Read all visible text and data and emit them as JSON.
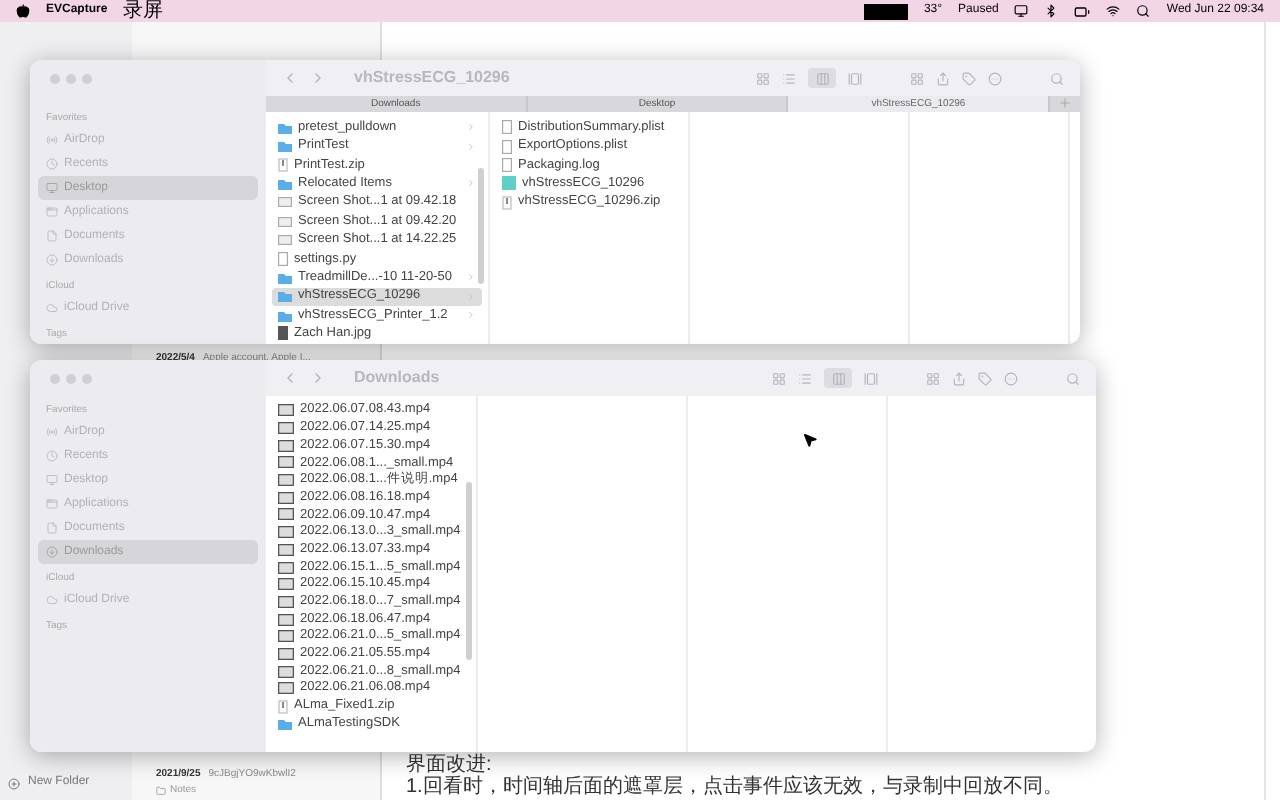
{
  "menu_bar": {
    "app_name": "EVCapture",
    "menu_items": [
      "录屏"
    ],
    "status_items": [
      "33°",
      "Paused"
    ],
    "clock": "Wed Jun 22 09:34"
  },
  "background_app": {
    "notes": [
      {
        "date": "2022/5/4",
        "title": "Apple account. Apple I..."
      },
      {
        "date": "2021/9/25",
        "title": "9cJBgjYO9wKbwlI2",
        "folder": "Notes"
      }
    ],
    "body_heading": "界面改进:",
    "body_text": "1.回看时，时间轴后面的遮罩层，点击事件应该无效，与录制中回放不同。",
    "new_folder": "New Folder"
  },
  "windows": [
    {
      "title": "vhStressECG_10296",
      "tabs": [
        {
          "label": "Downloads",
          "selected": false
        },
        {
          "label": "Desktop",
          "selected": false
        },
        {
          "label": "vhStressECG_10296",
          "selected": true
        }
      ],
      "sidebar": [
        {
          "heading": "Favorites",
          "items": [
            {
              "label": "AirDrop",
              "kind": "airdrop",
              "selected": false
            },
            {
              "label": "Recents",
              "kind": "recents",
              "selected": false
            },
            {
              "label": "Desktop",
              "kind": "desktop",
              "selected": true
            },
            {
              "label": "Applications",
              "kind": "applications",
              "selected": false
            },
            {
              "label": "Documents",
              "kind": "documents",
              "selected": false
            },
            {
              "label": "Downloads",
              "kind": "downloads",
              "selected": false
            }
          ]
        },
        {
          "heading": "iCloud",
          "items": [
            {
              "label": "iCloud Drive",
              "kind": "cloud",
              "selected": false
            }
          ]
        },
        {
          "heading": "Tags"
        }
      ],
      "columns": [
        [
          {
            "name": "pretest_pulldown",
            "kind": "folder",
            "selected": false,
            "has_children": true
          },
          {
            "name": "PrintTest",
            "kind": "folder",
            "selected": false,
            "has_children": true
          },
          {
            "name": "PrintTest.zip",
            "kind": "zip",
            "selected": false,
            "has_children": false
          },
          {
            "name": "Relocated Items",
            "kind": "folder",
            "selected": false,
            "has_children": true
          },
          {
            "name": "Screen Shot...1 at 09.42.18",
            "kind": "image",
            "selected": false,
            "has_children": false
          },
          {
            "name": "Screen Shot...1 at 09.42.20",
            "kind": "image",
            "selected": false,
            "has_children": false
          },
          {
            "name": "Screen Shot...1 at 14.22.25",
            "kind": "image",
            "selected": false,
            "has_children": false
          },
          {
            "name": "settings.py",
            "kind": "document",
            "selected": false,
            "has_children": false
          },
          {
            "name": "TreadmillDe...-10 11-20-50",
            "kind": "folder",
            "selected": false,
            "has_children": true
          },
          {
            "name": "vhStressECG_10296",
            "kind": "folder",
            "selected": true,
            "has_children": true
          },
          {
            "name": "vhStressECG_Printer_1.2",
            "kind": "folder",
            "selected": false,
            "has_children": true
          },
          {
            "name": "Zach Han.jpg",
            "kind": "photo",
            "selected": false,
            "has_children": false
          }
        ],
        [
          {
            "name": "DistributionSummary.plist",
            "kind": "document",
            "selected": false,
            "has_children": false
          },
          {
            "name": "ExportOptions.plist",
            "kind": "document",
            "selected": false,
            "has_children": false
          },
          {
            "name": "Packaging.log",
            "kind": "document",
            "selected": false,
            "has_children": false
          },
          {
            "name": "vhStressECG_10296",
            "kind": "app",
            "selected": false,
            "has_children": false
          },
          {
            "name": "vhStressECG_10296.zip",
            "kind": "zip",
            "selected": false,
            "has_children": false
          }
        ],
        [],
        []
      ]
    },
    {
      "title": "Downloads",
      "sidebar": [
        {
          "heading": "Favorites",
          "items": [
            {
              "label": "AirDrop",
              "kind": "airdrop",
              "selected": false
            },
            {
              "label": "Recents",
              "kind": "recents",
              "selected": false
            },
            {
              "label": "Desktop",
              "kind": "desktop",
              "selected": false
            },
            {
              "label": "Applications",
              "kind": "applications",
              "selected": false
            },
            {
              "label": "Documents",
              "kind": "documents",
              "selected": false
            },
            {
              "label": "Downloads",
              "kind": "downloads",
              "selected": true
            }
          ]
        },
        {
          "heading": "iCloud",
          "items": [
            {
              "label": "iCloud Drive",
              "kind": "cloud",
              "selected": false
            }
          ]
        },
        {
          "heading": "Tags"
        }
      ],
      "columns": [
        [
          {
            "name": "2022.06.07.08.43.mp4",
            "kind": "video",
            "selected": false,
            "has_children": false
          },
          {
            "name": "2022.06.07.14.25.mp4",
            "kind": "video",
            "selected": false,
            "has_children": false
          },
          {
            "name": "2022.06.07.15.30.mp4",
            "kind": "video",
            "selected": false,
            "has_children": false
          },
          {
            "name": "2022.06.08.1..._small.mp4",
            "kind": "video",
            "selected": false,
            "has_children": false
          },
          {
            "name": "2022.06.08.1...件说明.mp4",
            "kind": "video",
            "selected": false,
            "has_children": false
          },
          {
            "name": "2022.06.08.16.18.mp4",
            "kind": "video",
            "selected": false,
            "has_children": false
          },
          {
            "name": "2022.06.09.10.47.mp4",
            "kind": "video",
            "selected": false,
            "has_children": false
          },
          {
            "name": "2022.06.13.0...3_small.mp4",
            "kind": "video",
            "selected": false,
            "has_children": false
          },
          {
            "name": "2022.06.13.07.33.mp4",
            "kind": "video",
            "selected": false,
            "has_children": false
          },
          {
            "name": "2022.06.15.1...5_small.mp4",
            "kind": "video",
            "selected": false,
            "has_children": false
          },
          {
            "name": "2022.06.15.10.45.mp4",
            "kind": "video",
            "selected": false,
            "has_children": false
          },
          {
            "name": "2022.06.18.0...7_small.mp4",
            "kind": "video",
            "selected": false,
            "has_children": false
          },
          {
            "name": "2022.06.18.06.47.mp4",
            "kind": "video",
            "selected": false,
            "has_children": false
          },
          {
            "name": "2022.06.21.0...5_small.mp4",
            "kind": "video",
            "selected": false,
            "has_children": false
          },
          {
            "name": "2022.06.21.05.55.mp4",
            "kind": "video",
            "selected": false,
            "has_children": false
          },
          {
            "name": "2022.06.21.0...8_small.mp4",
            "kind": "video",
            "selected": false,
            "has_children": false
          },
          {
            "name": "2022.06.21.06.08.mp4",
            "kind": "video",
            "selected": false,
            "has_children": false
          },
          {
            "name": "ALma_Fixed1.zip",
            "kind": "zip",
            "selected": false,
            "has_children": false
          },
          {
            "name": "ALmaTestingSDK",
            "kind": "folder",
            "selected": false,
            "has_children": false
          }
        ],
        [],
        []
      ]
    }
  ]
}
